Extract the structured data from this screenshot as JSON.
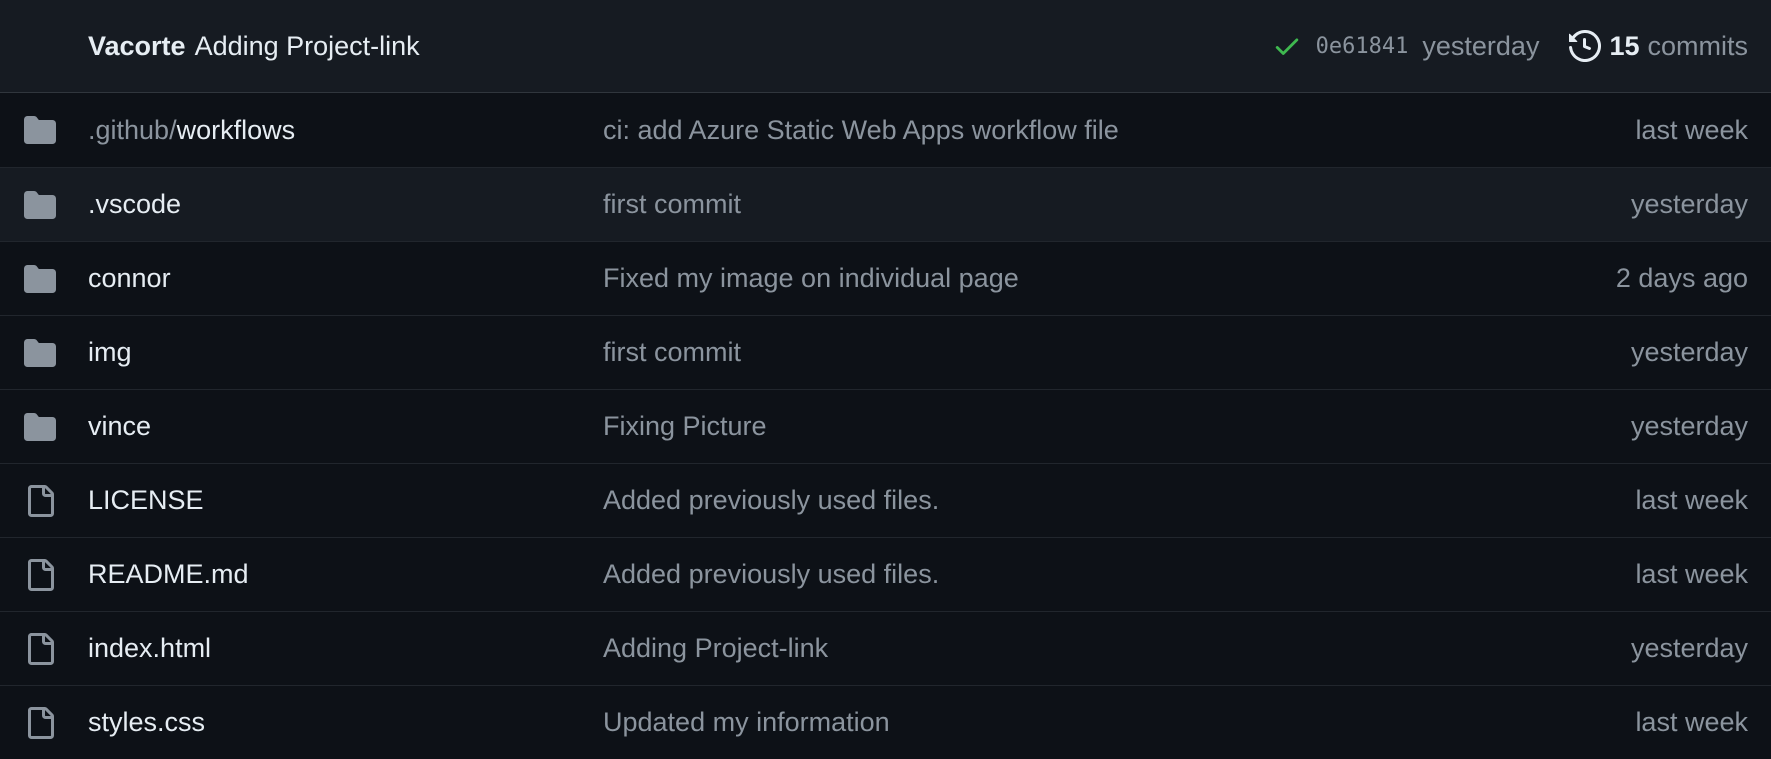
{
  "latest_commit": {
    "author": "Vacorte",
    "message": "Adding Project-link",
    "sha": "0e61841",
    "when": "yesterday",
    "commit_count": "15",
    "commits_label": "commits",
    "check_color": "#3fb950"
  },
  "files": [
    {
      "type": "folder",
      "icon": "folder-icon",
      "prefix": ".github/",
      "name": "workflows",
      "message": "ci: add Azure Static Web Apps workflow file",
      "age": "last week"
    },
    {
      "type": "folder",
      "icon": "folder-icon",
      "prefix": "",
      "name": ".vscode",
      "message": "first commit",
      "age": "yesterday"
    },
    {
      "type": "folder",
      "icon": "folder-icon",
      "prefix": "",
      "name": "connor",
      "message": "Fixed my image on individual page",
      "age": "2 days ago"
    },
    {
      "type": "folder",
      "icon": "folder-icon",
      "prefix": "",
      "name": "img",
      "message": "first commit",
      "age": "yesterday"
    },
    {
      "type": "folder",
      "icon": "folder-icon",
      "prefix": "",
      "name": "vince",
      "message": "Fixing Picture",
      "age": "yesterday"
    },
    {
      "type": "file",
      "icon": "file-icon",
      "prefix": "",
      "name": "LICENSE",
      "message": "Added previously used files.",
      "age": "last week"
    },
    {
      "type": "file",
      "icon": "file-icon",
      "prefix": "",
      "name": "README.md",
      "message": "Added previously used files.",
      "age": "last week"
    },
    {
      "type": "file",
      "icon": "file-icon",
      "prefix": "",
      "name": "index.html",
      "message": "Adding Project-link",
      "age": "yesterday"
    },
    {
      "type": "file",
      "icon": "file-icon",
      "prefix": "",
      "name": "styles.css",
      "message": "Updated my information",
      "age": "last week"
    }
  ]
}
